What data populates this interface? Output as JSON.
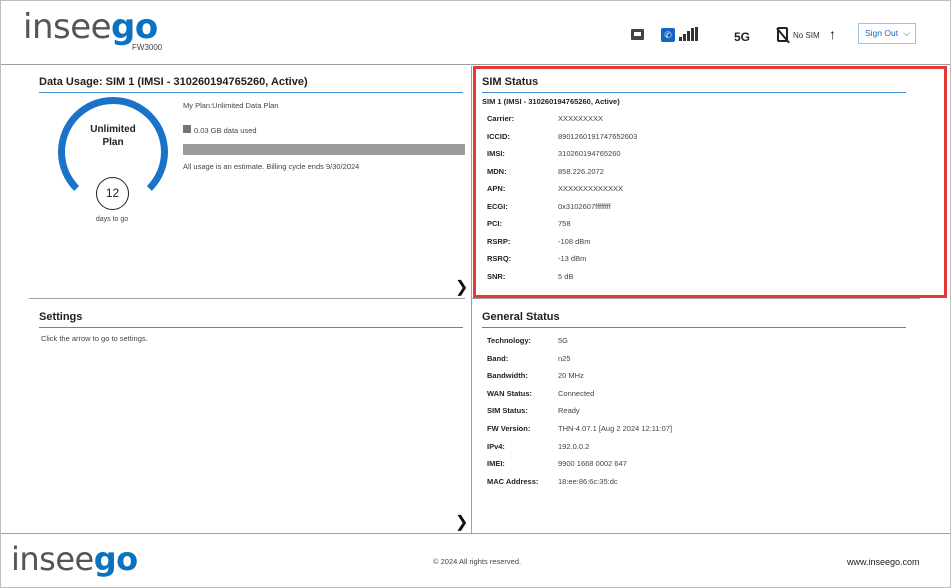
{
  "header": {
    "logo_part1": "insee",
    "logo_part2": "go",
    "model": "FW3000",
    "network_type": "5G",
    "sim_state": "No SIM",
    "sign_out_label": "Sign Out"
  },
  "data_usage": {
    "title": "Data Usage:  SIM 1 (IMSI - 310260194765260, Active)",
    "ring_line1": "Unlimited",
    "ring_line2": "Plan",
    "days_to_go": "12",
    "days_label": "days to go",
    "plan_text": "My Plan:Unlimited Data Plan",
    "used_text": "0.03 GB data used",
    "usage_fraction": 0.0,
    "estimate_text": "All usage is an estimate. Billing cycle ends 9/30/2024"
  },
  "settings": {
    "title": "Settings",
    "text": "Click the arrow to go to settings."
  },
  "sim_status": {
    "title": "SIM Status",
    "subtitle": "SIM 1 (IMSI - 310260194765260, Active)",
    "rows": [
      {
        "label": "Carrier:",
        "value": "XXXXXXXXX"
      },
      {
        "label": "ICCID:",
        "value": "8901260191747652603"
      },
      {
        "label": "IMSI:",
        "value": "310260194765260"
      },
      {
        "label": "MDN:",
        "value": "858.226.2072"
      },
      {
        "label": "APN:",
        "value": "XXXXXXXXXXXXX"
      },
      {
        "label": "ECGI:",
        "value": "0x3102607ffffffff"
      },
      {
        "label": "PCI:",
        "value": "758"
      },
      {
        "label": "RSRP:",
        "value": "-108 dBm"
      },
      {
        "label": "RSRQ:",
        "value": "-13 dBm"
      },
      {
        "label": "SNR:",
        "value": "5 dB"
      }
    ]
  },
  "general_status": {
    "title": "General Status",
    "rows": [
      {
        "label": "Technology:",
        "value": "5G"
      },
      {
        "label": "Band:",
        "value": "n25"
      },
      {
        "label": "Bandwidth:",
        "value": "20 MHz"
      },
      {
        "label": "WAN Status:",
        "value": "Connected"
      },
      {
        "label": "SIM Status:",
        "value": "Ready"
      },
      {
        "label": "FW Version:",
        "value": "THN-4.07.1 [Aug 2 2024 12:11:07]"
      },
      {
        "label": "IPv4:",
        "value": "192.0.0.2"
      },
      {
        "label": "IMEI:",
        "value": "9900 1668 0002 647"
      },
      {
        "label": "MAC Address:",
        "value": "18:ee:86:6c:35:dc"
      }
    ]
  },
  "footer": {
    "copyright": "© 2024 All rights reserved.",
    "website": "www.inseego.com"
  },
  "colors": {
    "brand_blue": "#0b72c1",
    "highlight_red": "#e53935"
  }
}
